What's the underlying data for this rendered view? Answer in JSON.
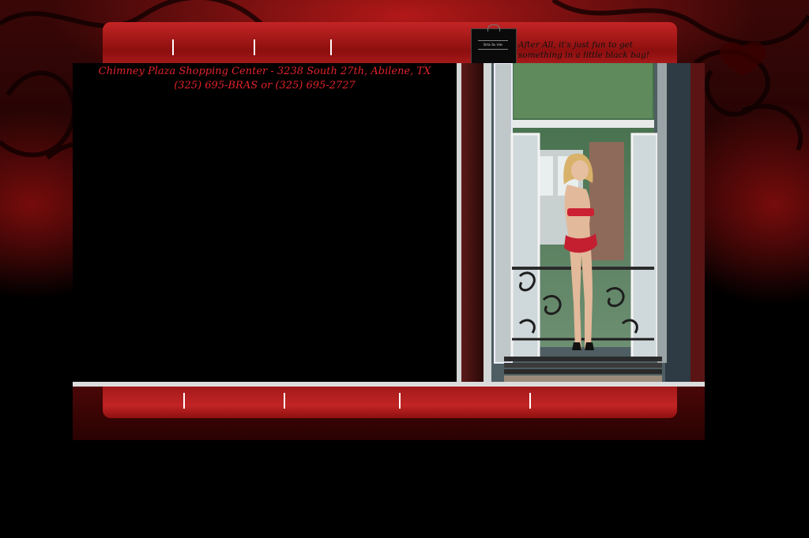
{
  "header": {
    "tagline_line1": "After All,  it's just fun to get",
    "tagline_line2": "something in a little black bag!",
    "bag_logo_text": "bra la vie"
  },
  "content": {
    "address_line1": "Chimney Plaza Shopping Center - 3238 South 27th, Abilene, TX",
    "address_line2": "(325) 695-BRAS or (325) 695-2727"
  },
  "colors": {
    "accent_red": "#e2232a",
    "bar_red": "#b81c1c",
    "background": "#000000"
  }
}
